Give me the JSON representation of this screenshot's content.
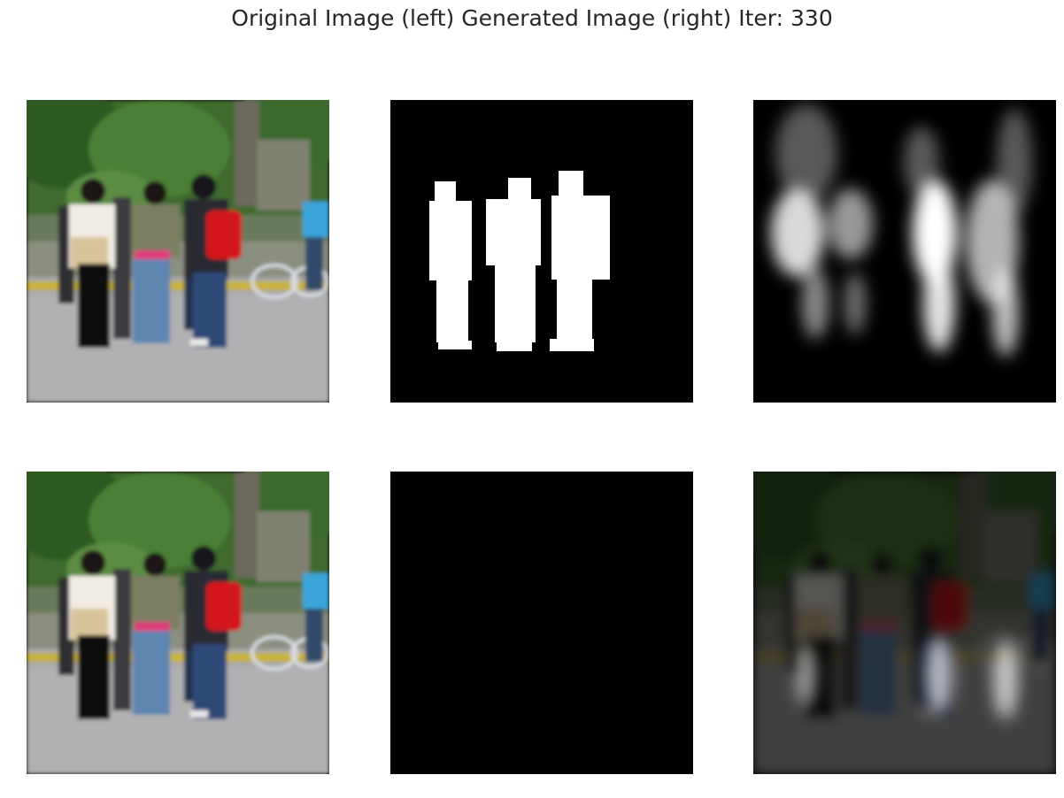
{
  "figure": {
    "title": "Original Image (left) Generated Image (right) Iter: 330"
  },
  "colors": {
    "background": "#ffffff",
    "title_text": "#262626",
    "mask_fg": "#ffffff",
    "mask_bg": "#000000",
    "backpack_red": "#d3141f",
    "jeans_blue": "#5f86b0",
    "foliage_green": "#3c6b2c",
    "road_gray": "#a9a9a9"
  },
  "panels": [
    {
      "row": 1,
      "col": 1,
      "content": "original photo"
    },
    {
      "row": 1,
      "col": 2,
      "content": "ground-truth mask"
    },
    {
      "row": 1,
      "col": 3,
      "content": "generated mask"
    },
    {
      "row": 2,
      "col": 1,
      "content": "original photo"
    },
    {
      "row": 2,
      "col": 2,
      "content": "masked people"
    },
    {
      "row": 2,
      "col": 3,
      "content": "generated masked image"
    }
  ]
}
